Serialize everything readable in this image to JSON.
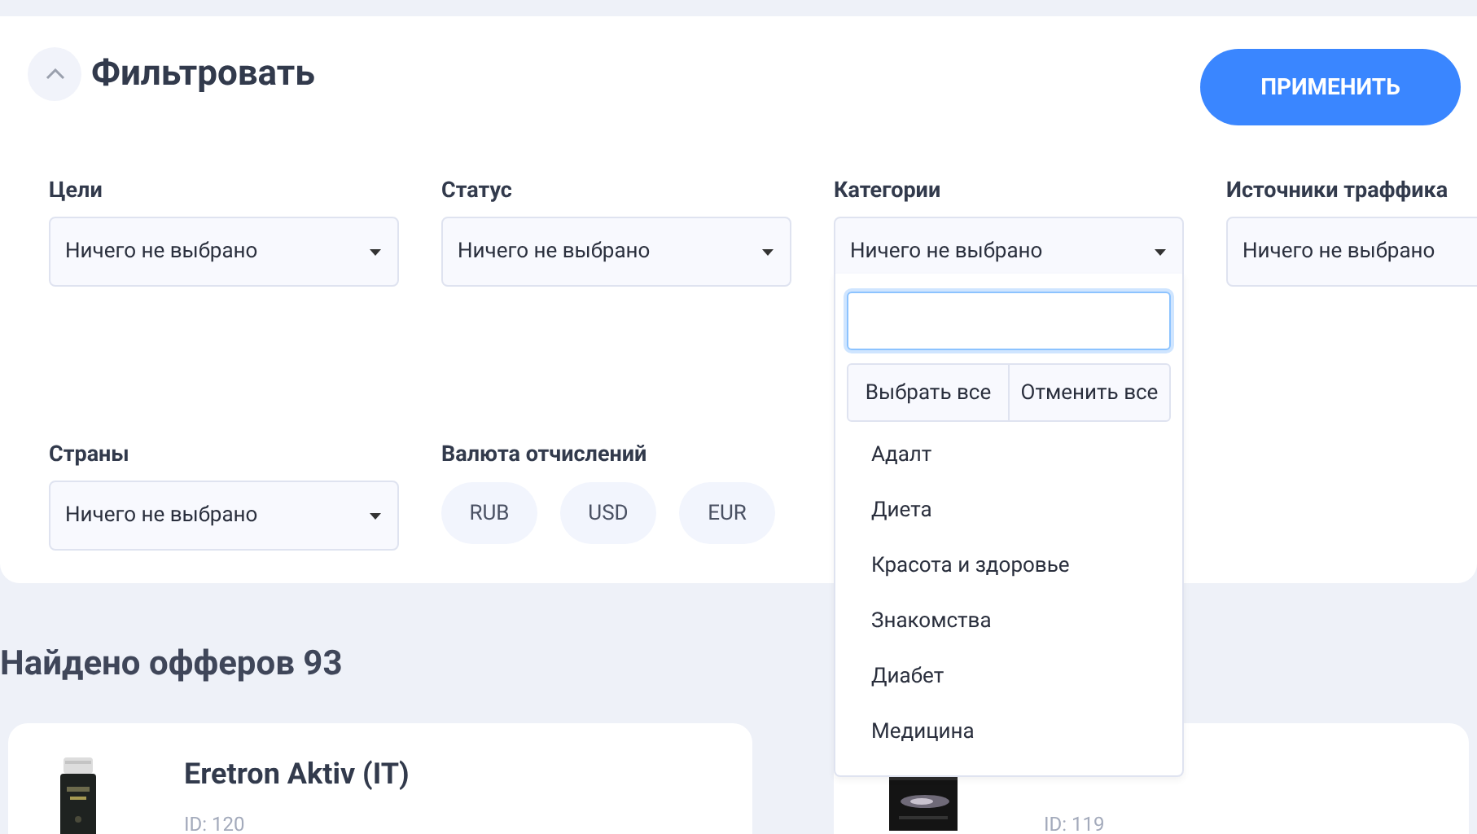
{
  "filter": {
    "title": "Фильтровать",
    "collapse_expanded": true,
    "apply_button": "ПРИМЕНИТЬ",
    "fields": [
      {
        "label": "Цели",
        "value": "Ничего не выбрано",
        "open": false
      },
      {
        "label": "Статус",
        "value": "Ничего не выбрано",
        "open": false
      },
      {
        "label": "Категории",
        "value": "Ничего не выбрано",
        "open": true
      },
      {
        "label": "Источники траффика",
        "value": "Ничего не выбрано",
        "open": false
      },
      {
        "label": "Страны",
        "value": "Ничего не выбрано",
        "open": false
      }
    ],
    "currency": {
      "label": "Валюта отчислений",
      "options": [
        {
          "label": "RUB",
          "selected": false
        },
        {
          "label": "USD",
          "selected": false
        },
        {
          "label": "EUR",
          "selected": false
        }
      ]
    }
  },
  "dropdown": {
    "select_all": "Выбрать все",
    "deselect_all": "Отменить все",
    "items": [
      "Адалт",
      "Диета",
      "Красота и здоровье",
      "Знакомства",
      "Диабет",
      "Медицина"
    ]
  },
  "results": {
    "heading": "Найдено офферов 93",
    "offers": [
      {
        "title": "Eretron Aktiv (IT)",
        "id": "ID: 120"
      },
      {
        "id": "ID: 119"
      }
    ]
  }
}
